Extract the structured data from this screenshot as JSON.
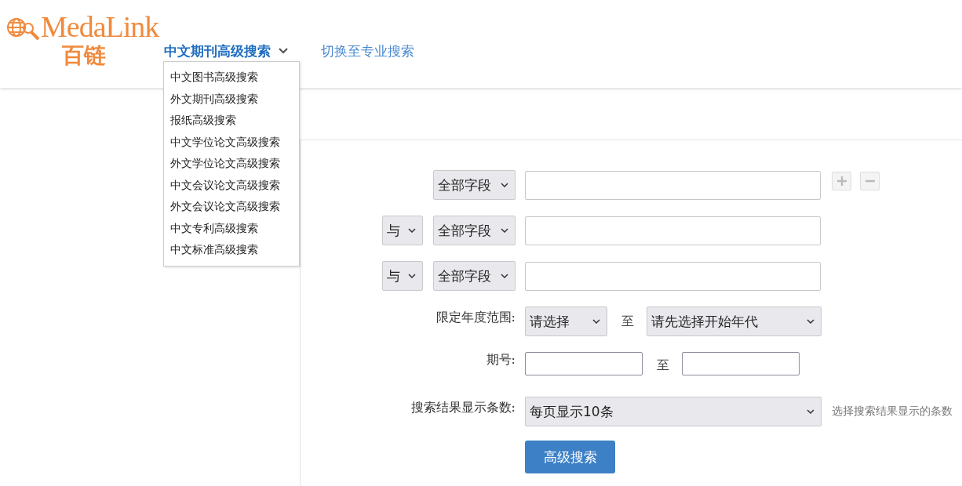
{
  "logo": {
    "text": "MedaLink",
    "subtitle": "百链"
  },
  "nav": {
    "current": "中文期刊高级搜索",
    "expanded": true,
    "menu": [
      "中文图书高级搜索",
      "外文期刊高级搜索",
      "报纸高级搜索",
      "中文学位论文高级搜索",
      "外文学位论文高级搜索",
      "中文会议论文高级搜索",
      "外文会议论文高级搜索",
      "中文专利高级搜索",
      "中文标准高级搜索"
    ],
    "switch_link": "切换至专业搜索"
  },
  "form": {
    "rows": [
      {
        "kind": "term",
        "field": "全部字段",
        "value": ""
      },
      {
        "kind": "term",
        "operator": "与",
        "field": "全部字段",
        "value": ""
      },
      {
        "kind": "term",
        "operator": "与",
        "field": "全部字段",
        "value": ""
      },
      {
        "kind": "range",
        "label": "限定年度范围:",
        "from": "请选择",
        "separator": "至",
        "to": "请先选择开始年代"
      },
      {
        "kind": "issue",
        "label": "期号:",
        "separator": "至"
      },
      {
        "kind": "count",
        "label": "搜索结果显示条数:",
        "value": "每页显示10条",
        "hint": "选择搜索结果显示的条数"
      }
    ],
    "submit": "高级搜索"
  }
}
